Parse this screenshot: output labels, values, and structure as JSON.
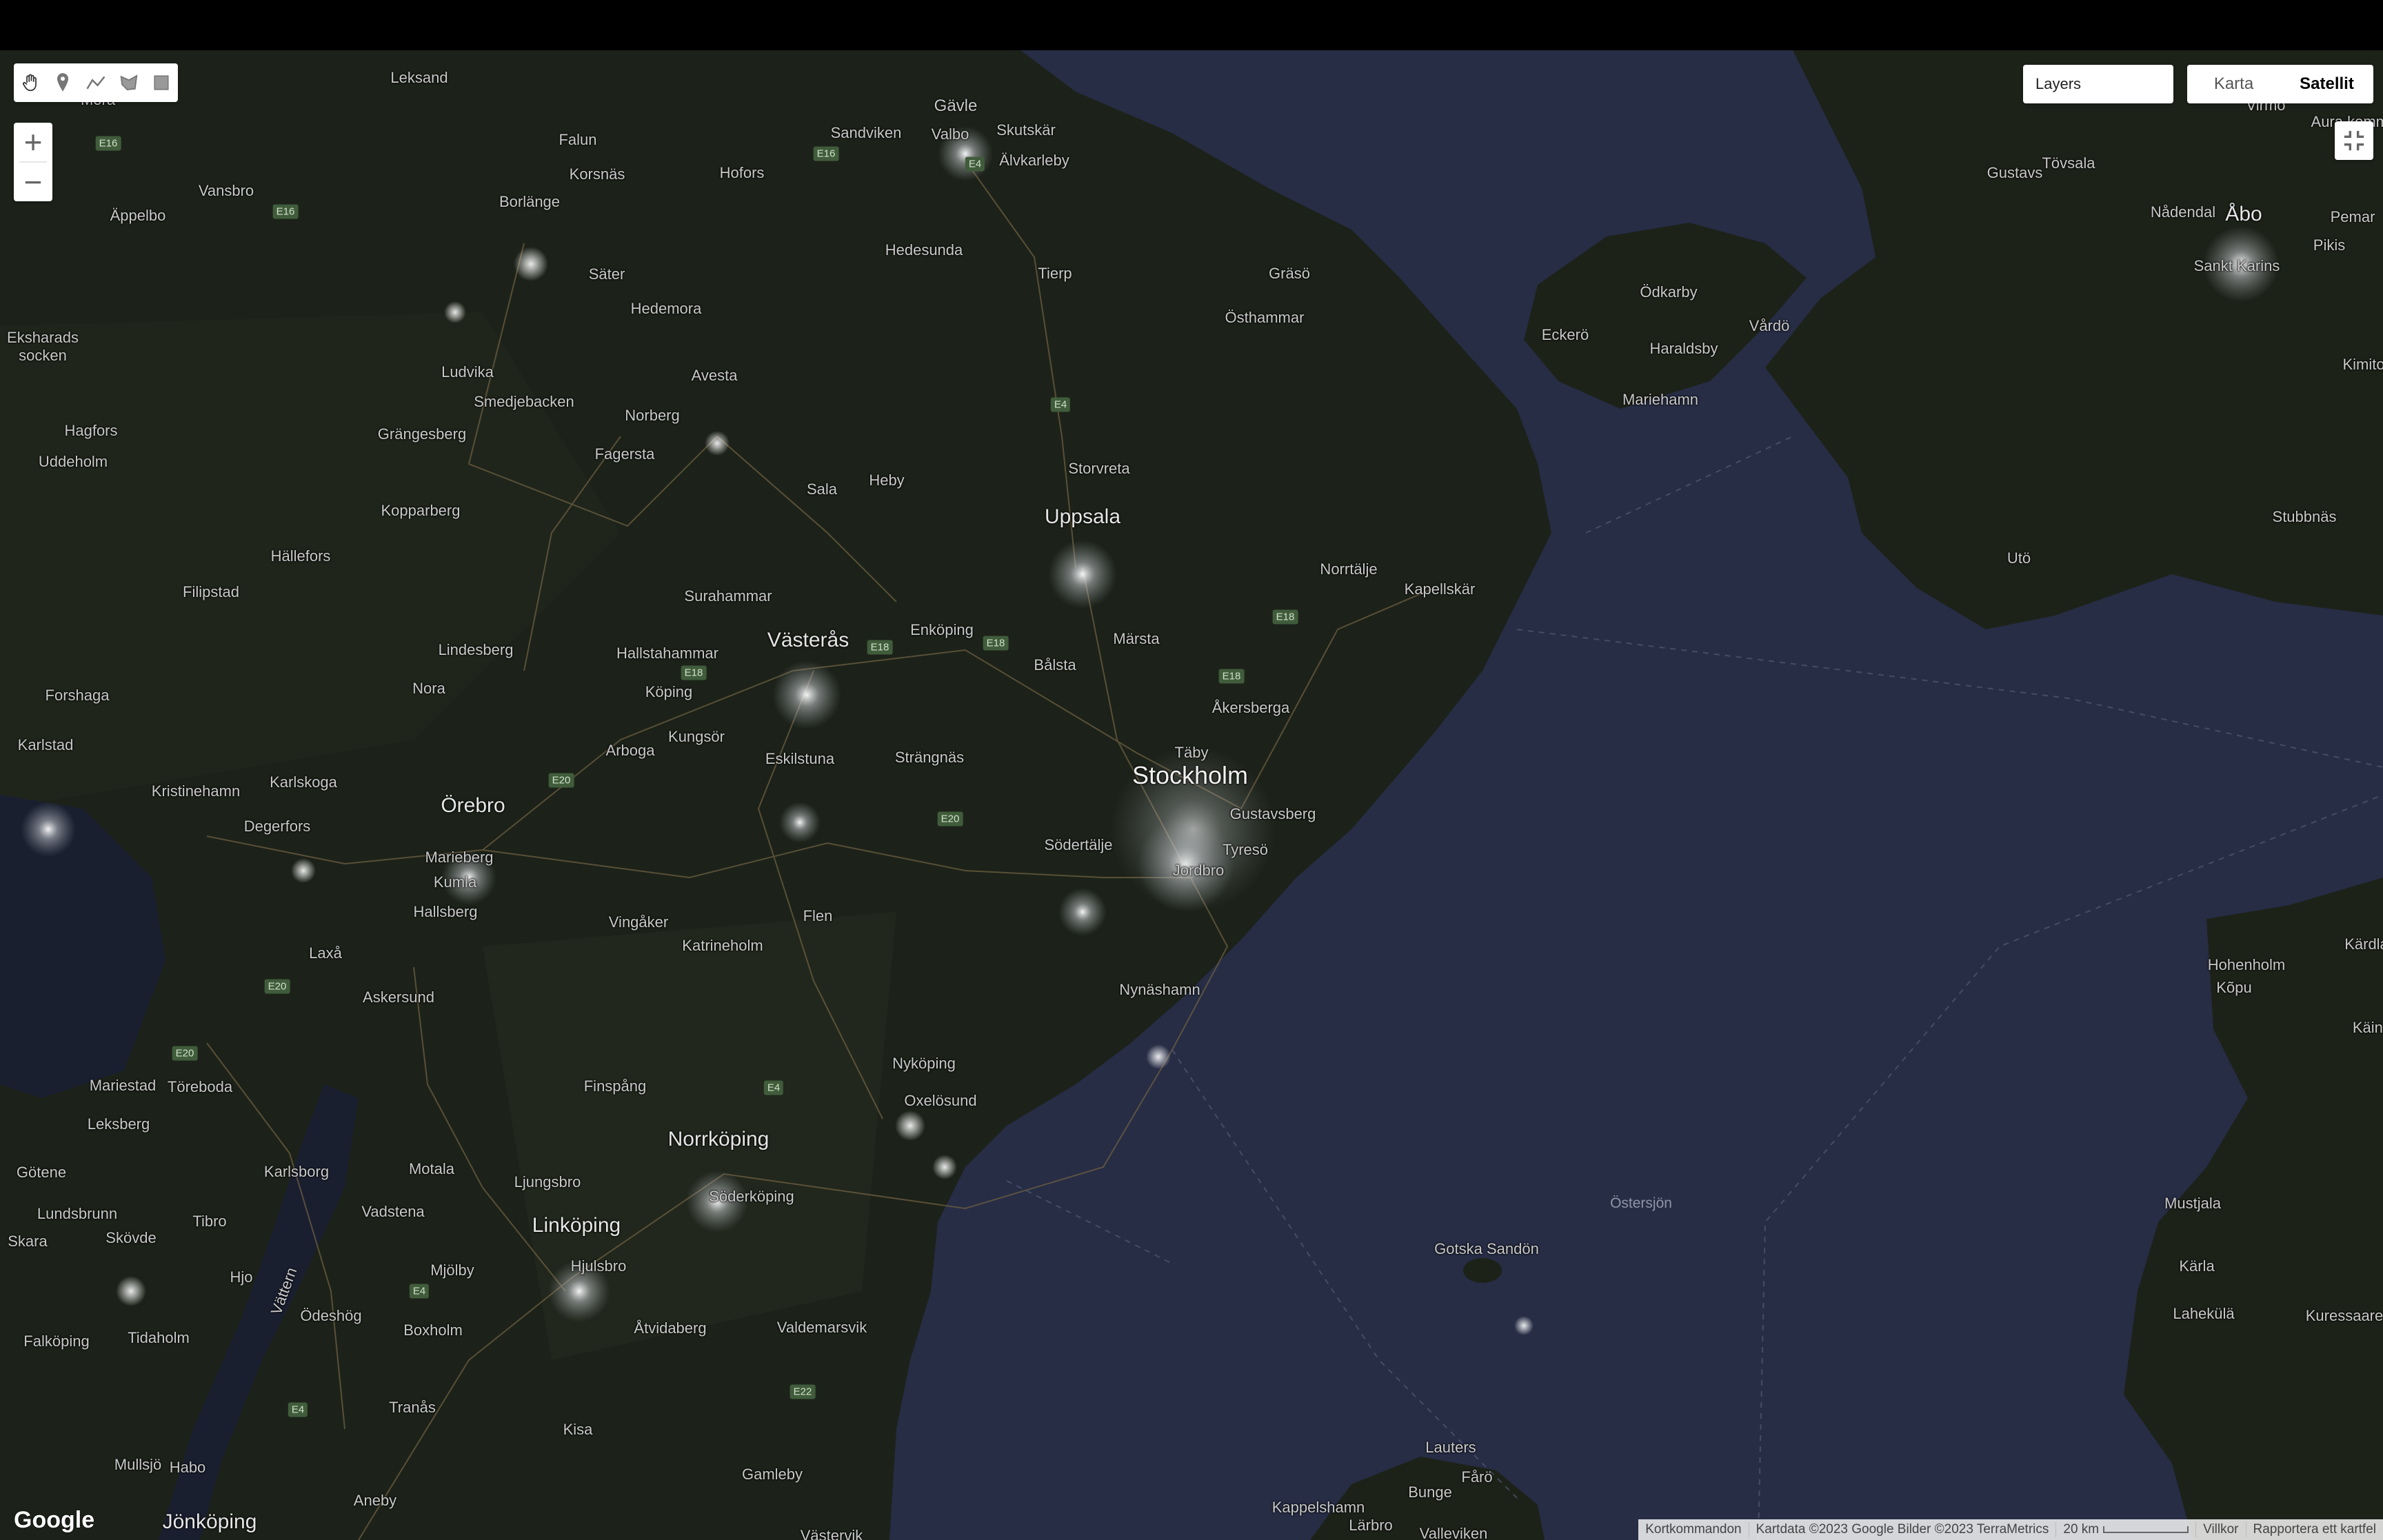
{
  "toolbar": {
    "draw_tools": [
      "hand-icon",
      "marker-icon",
      "line-icon",
      "polygon-icon",
      "rectangle-icon"
    ]
  },
  "zoom": {
    "in_label": "+",
    "out_label": "−"
  },
  "layers": {
    "label": "Layers"
  },
  "map_type": {
    "options": [
      "Karta",
      "Satellit"
    ],
    "selected": "Satellit"
  },
  "footer": {
    "logo": "Google",
    "shortcuts": "Kortkommandon",
    "map_data": "Kartdata ©2023 Google Bilder ©2023 TerraMetrics",
    "scale": "20 km",
    "terms": "Villkor",
    "report": "Rapportera ett kartfel"
  },
  "places": {
    "stockholm": "Stockholm",
    "uppsala": "Uppsala",
    "vasteras": "Västerås",
    "orebro": "Örebro",
    "norrkoping": "Norrköping",
    "linkoping": "Linköping",
    "jonkoping": "Jönköping",
    "abo": "Åbo",
    "gavle": "Gävle",
    "falun": "Falun",
    "borlange": "Borlänge",
    "sandviken": "Sandviken",
    "leksand": "Leksand",
    "mora": "Mora",
    "vansbro": "Vansbro",
    "appelbo": "Äppelbo",
    "korsnas": "Korsnäs",
    "hofors": "Hofors",
    "valbo": "Valbo",
    "skutskar": "Skutskär",
    "alvkarleby": "Älvkarleby",
    "hedesunda": "Hedesunda",
    "tierp": "Tierp",
    "grasö": "Gräsö",
    "osthammar": "Östhammar",
    "sater": "Säter",
    "hedemora": "Hedemora",
    "avesta": "Avesta",
    "ludvika": "Ludvika",
    "smedjebacken": "Smedjebacken",
    "norberg": "Norberg",
    "grangesberg": "Grängesberg",
    "fagersta": "Fagersta",
    "eksharad": "Eksharads\nsocken",
    "hagfors": "Hagfors",
    "uddeholm": "Uddeholm",
    "kopparberg": "Kopparberg",
    "hallefors": "Hällefors",
    "filipstad": "Filipstad",
    "lindesberg": "Lindesberg",
    "nora": "Nora",
    "forshaga": "Forshaga",
    "karlstad": "Karlstad",
    "kristinehamn": "Kristinehamn",
    "karlskoga": "Karlskoga",
    "degerfors": "Degerfors",
    "storvreta": "Storvreta",
    "sala": "Sala",
    "heby": "Heby",
    "surahammar": "Surahammar",
    "hallstahammar": "Hallstahammar",
    "koping": "Köping",
    "kungsor": "Kungsör",
    "arboga": "Arboga",
    "eskilstuna": "Eskilstuna",
    "strangnas": "Strängnäs",
    "enkoping": "Enköping",
    "balsta": "Bålsta",
    "marsta": "Märsta",
    "norrtalje": "Norrtälje",
    "kapellskar": "Kapellskär",
    "akersberga": "Åkersberga",
    "taby": "Täby",
    "gustavsberg": "Gustavsberg",
    "tyreso": "Tyresö",
    "sodertalje": "Södertälje",
    "jordbro": "Jordbro",
    "nynashamn": "Nynäshamn",
    "marieberg": "Marieberg",
    "kumla": "Kumla",
    "hallsberg": "Hallsberg",
    "vingaker": "Vingåker",
    "flen": "Flen",
    "katrineholm": "Katrineholm",
    "laxa": "Laxå",
    "askersund": "Askersund",
    "nykoping": "Nyköping",
    "oxelosund": "Oxelösund",
    "finspang": "Finspång",
    "mariestad": "Mariestad",
    "toreboda": "Töreboda",
    "leksberg": "Leksberg",
    "gotene": "Götene",
    "lundsbrunn": "Lundsbrunn",
    "skara": "Skara",
    "tibro": "Tibro",
    "skovde": "Skövde",
    "karlsborg": "Karlsborg",
    "motala": "Motala",
    "ljungsbro": "Ljungsbro",
    "soderkoping": "Söderköping",
    "vadstena": "Vadstena",
    "mjolby": "Mjölby",
    "hjulsbro": "Hjulsbro",
    "hjo": "Hjo",
    "vattern": "Vättern",
    "odeshog": "Ödeshög",
    "boxholm": "Boxholm",
    "atvidaberg": "Åtvidaberg",
    "valdemarsvik": "Valdemarsvik",
    "falkoping": "Falköping",
    "tidaholm": "Tidaholm",
    "tranas": "Tranås",
    "kisa": "Kisa",
    "gamleby": "Gamleby",
    "mullsjo": "Mullsjö",
    "habo": "Habo",
    "aneby": "Aneby",
    "vastervik": "Västervik",
    "ostersjon": "Östersjön",
    "gotska": "Gotska Sandön",
    "lauters": "Lauters",
    "faro": "Fårö",
    "bunge": "Bunge",
    "kappelshamn": "Kappelshamn",
    "larbro": "Lärbro",
    "valleviken": "Valleviken",
    "eckero": "Eckerö",
    "odkarby": "Ödkarby",
    "vardo": "Vårdö",
    "haraldsby": "Haraldsby",
    "mariehamn": "Mariehamn",
    "gustavs": "Gustavs",
    "tovsala": "Tövsala",
    "aura": "Aura kommun",
    "vinno": "Virmo",
    "nadendal": "Nådendal",
    "pemar": "Pemar",
    "pikis": "Pikis",
    "sankt_karins": "Sankt Karins",
    "kimito": "Kimito",
    "stubbnas": "Stubbnäs",
    "uto": "Utö",
    "hohenholm": "Hohenholm",
    "kopu": "Kõpu",
    "karda": "Kärdla",
    "kain": "Käina",
    "mustjala": "Mustjala",
    "karla": "Kärla",
    "laheküla": "Lahekülä",
    "kuressaare": "Kuressaare"
  },
  "road_shields": [
    "E16",
    "E16",
    "E16",
    "E4",
    "E4",
    "E18",
    "E18",
    "E18",
    "E18",
    "E18",
    "E20",
    "E20",
    "E20",
    "E20",
    "E4",
    "E4",
    "E22",
    "E4"
  ],
  "colors": {
    "land": "#1d231a",
    "sea": "#272d45",
    "city_glow": "#e8e8e8",
    "road": "#7a6b4a"
  }
}
